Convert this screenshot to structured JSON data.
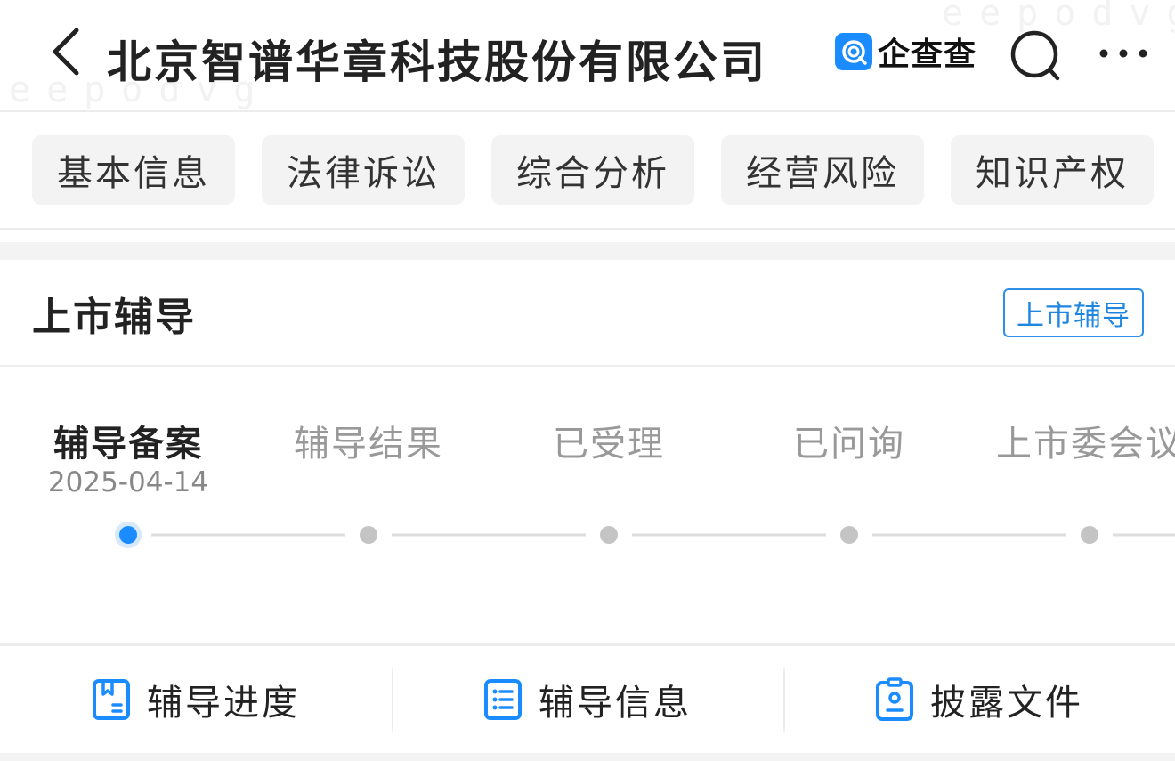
{
  "header": {
    "title": "北京智谱华章科技股份有限公司",
    "brand_label": "企查查",
    "back_icon": "chevron-left-icon",
    "search_icon": "search-icon",
    "more_icon": "more-horizontal-icon",
    "watermark": "eepodvg"
  },
  "tabs": [
    {
      "label": "基本信息"
    },
    {
      "label": "法律诉讼"
    },
    {
      "label": "综合分析"
    },
    {
      "label": "经营风险"
    },
    {
      "label": "知识产权"
    }
  ],
  "section": {
    "title": "上市辅导",
    "badge": "上市辅导"
  },
  "steps": [
    {
      "label": "辅导备案",
      "date": "2025-04-14",
      "active": true
    },
    {
      "label": "辅导结果",
      "active": false
    },
    {
      "label": "已受理",
      "active": false
    },
    {
      "label": "已问询",
      "active": false
    },
    {
      "label": "上市委会议",
      "active": false
    }
  ],
  "bottom_actions": [
    {
      "label": "辅导进度",
      "icon": "bookmark-doc-icon"
    },
    {
      "label": "辅导信息",
      "icon": "list-doc-icon"
    },
    {
      "label": "披露文件",
      "icon": "id-badge-icon"
    }
  ],
  "colors": {
    "accent": "#1a8cff",
    "active_dot": "#1a8cff",
    "inactive_dot": "#c4c4c4",
    "tab_bg": "#f3f3f3"
  }
}
